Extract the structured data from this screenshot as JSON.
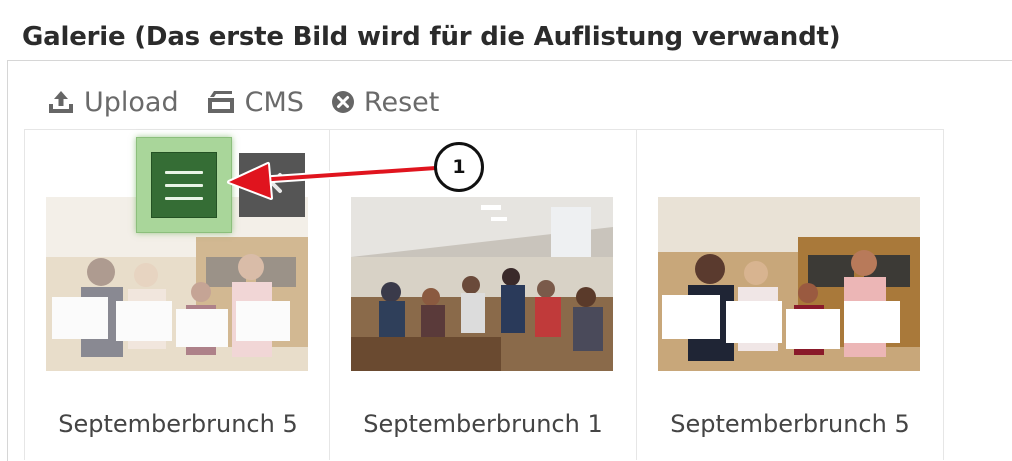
{
  "gallery": {
    "title": "Galerie (Das erste Bild wird für die Auflistung verwandt)"
  },
  "toolbar": {
    "upload_label": "Upload",
    "cms_label": "CMS",
    "reset_label": "Reset"
  },
  "items": [
    {
      "caption": "Septemberbrunch 5"
    },
    {
      "caption": "Septemberbrunch 1"
    },
    {
      "caption": "Septemberbrunch 5"
    }
  ],
  "annotation": {
    "marker": "1"
  },
  "colors": {
    "handle_outer": "#a9d69a",
    "handle_inner": "#356d35",
    "arrow": "#e0141e",
    "remove_button": "#555555"
  },
  "icons": [
    "upload-icon",
    "cms-icon",
    "reset-icon",
    "drag-menu-icon",
    "remove-icon"
  ]
}
